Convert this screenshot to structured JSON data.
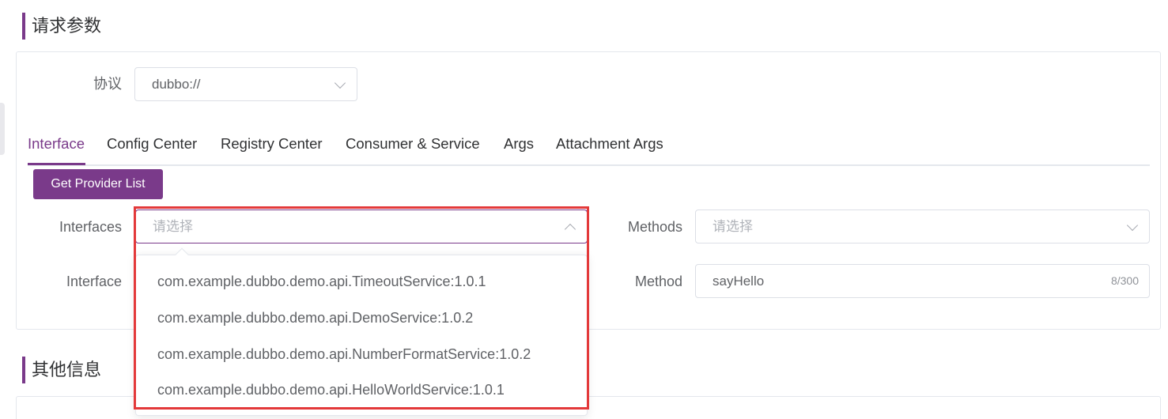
{
  "sections": {
    "request_params_title": "请求参数",
    "other_info_title": "其他信息"
  },
  "protocol": {
    "label": "协议",
    "value": "dubbo://"
  },
  "tabs": [
    {
      "label": "Interface",
      "active": true
    },
    {
      "label": "Config Center",
      "active": false
    },
    {
      "label": "Registry Center",
      "active": false
    },
    {
      "label": "Consumer & Service",
      "active": false
    },
    {
      "label": "Args",
      "active": false
    },
    {
      "label": "Attachment Args",
      "active": false
    }
  ],
  "get_provider_button": "Get Provider List",
  "interfaces_select": {
    "label": "Interfaces",
    "placeholder": "请选择",
    "options": [
      "com.example.dubbo.demo.api.TimeoutService:1.0.1",
      "com.example.dubbo.demo.api.DemoService:1.0.2",
      "com.example.dubbo.demo.api.NumberFormatService:1.0.2",
      "com.example.dubbo.demo.api.HelloWorldService:1.0.1"
    ]
  },
  "methods_select": {
    "label": "Methods",
    "placeholder": "请选择"
  },
  "interface_field": {
    "label": "Interface"
  },
  "method_field": {
    "label": "Method",
    "value": "sayHello",
    "counter": "8/300"
  },
  "colors": {
    "accent": "#7a3a8a",
    "highlight": "#e3393a"
  }
}
